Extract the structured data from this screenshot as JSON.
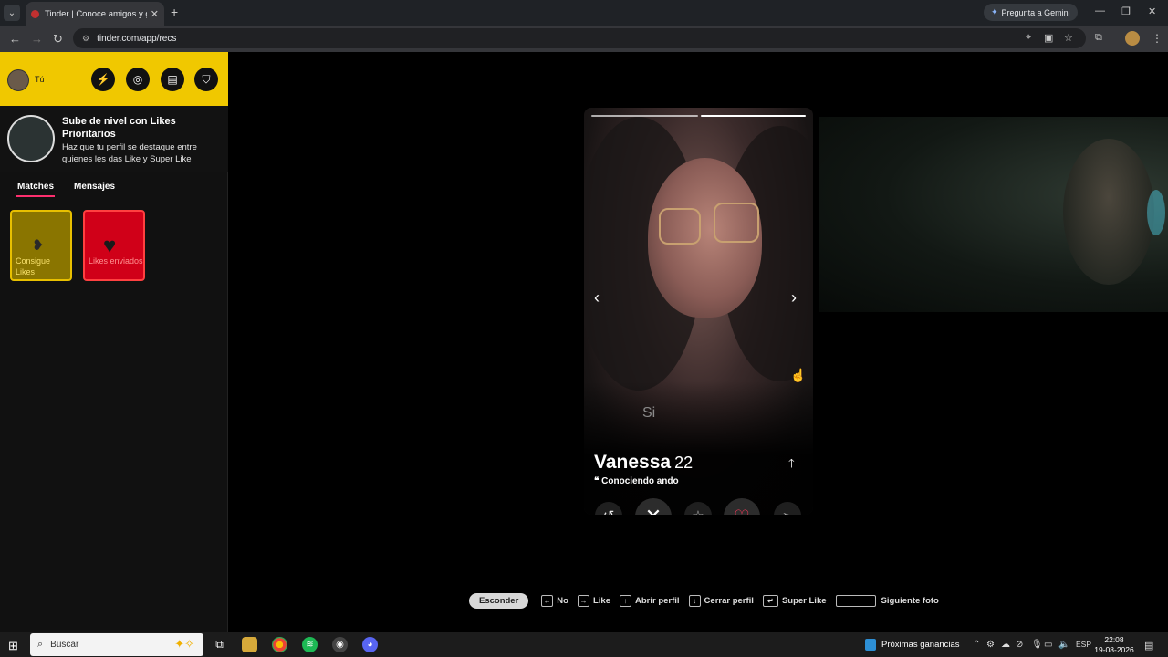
{
  "browser": {
    "tab_title": "Tinder | Conoce amigos y gente",
    "gemini_button": "Pregunta a Gemini",
    "url": "tinder.com/app/recs"
  },
  "sidebar": {
    "user_label": "Tú",
    "promo_title": "Sube de nivel con Likes Prioritarios",
    "promo_desc": "Haz que tu perfil se destaque entre quienes les das Like y Super Like",
    "tabs": [
      "Matches",
      "Mensajes"
    ],
    "active_tab": "Matches",
    "cards": [
      {
        "label": "Consigue Likes"
      },
      {
        "label": "Likes enviados"
      }
    ]
  },
  "profile_card": {
    "name": "Vanessa",
    "age": "22",
    "bio": "Conociendo ando",
    "photo_overlay_text": "Si",
    "photo_count": 2,
    "current_photo": 2
  },
  "shortcuts": {
    "hide_button": "Esconder",
    "items": [
      {
        "key": "←",
        "label": "No"
      },
      {
        "key": "→",
        "label": "Like"
      },
      {
        "key": "↑",
        "label": "Abrir perfil"
      },
      {
        "key": "↓",
        "label": "Cerrar perfil"
      },
      {
        "key": "↵",
        "label": "Super Like"
      },
      {
        "key": "space",
        "label": "Siguiente foto"
      }
    ]
  },
  "taskbar": {
    "search_placeholder": "Buscar",
    "news_widget": "Próximas ganancias",
    "language": "ESP",
    "time": "22:08",
    "date": "19-08-2026"
  },
  "colors": {
    "tinder_gold": "#f0c800",
    "tinder_red": "#d00018",
    "like_pink": "#ff3a5c",
    "tab_underline": "#fd2f6e"
  }
}
